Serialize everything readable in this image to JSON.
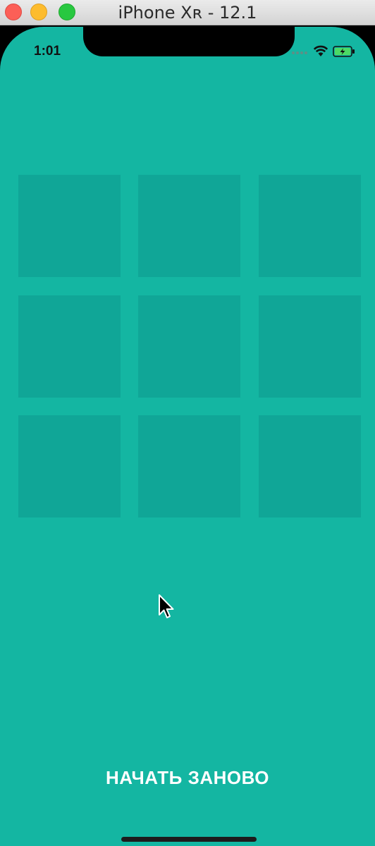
{
  "window": {
    "title": "iPhone Xʀ - 12.1",
    "controls": [
      "close",
      "minimize",
      "zoom"
    ]
  },
  "status_bar": {
    "time": "1:01",
    "icons": [
      "cellular-signal-icon",
      "wifi-icon",
      "battery-charging-icon"
    ]
  },
  "board": {
    "rows": 3,
    "cols": 3,
    "cells": [
      "",
      "",
      "",
      "",
      "",
      "",
      "",
      "",
      ""
    ]
  },
  "restart_button": {
    "label": "НАЧАТЬ ЗАНОВО"
  },
  "colors": {
    "background": "#14b6a2",
    "tile": "#10a697",
    "button_text": "#ffffff",
    "battery_green": "#4cd964"
  }
}
